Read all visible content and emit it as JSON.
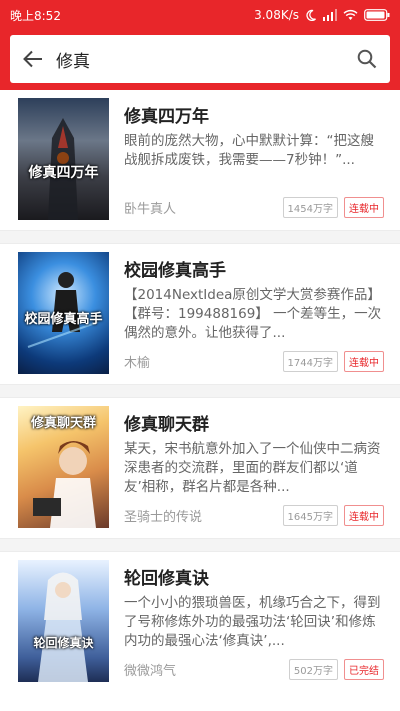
{
  "status_bar": {
    "time": "晚上8:52",
    "network_speed": "3.08K/s"
  },
  "search": {
    "query": "修真"
  },
  "results": [
    {
      "title": "修真四万年",
      "description": "眼前的庞然大物，心中默默计算：“把这艘战舰拆成废铁，我需要——7秒钟！”...",
      "author": "卧牛真人",
      "word_count": "1454万字",
      "status": "连载中",
      "cover_text": "修真四万年"
    },
    {
      "title": "校园修真高手",
      "description": "【2014NextIdea原创文学大赏参赛作品】【群号：199488169】 一个差等生，一次偶然的意外。让他获得了...",
      "author": "木榆",
      "word_count": "1744万字",
      "status": "连载中",
      "cover_text": "校园修真高手"
    },
    {
      "title": "修真聊天群",
      "description": "某天，宋书航意外加入了一个仙侠中二病资深患者的交流群，里面的群友们都以‘道友’相称，群名片都是各种...",
      "author": "圣骑士的传说",
      "word_count": "1645万字",
      "status": "连载中",
      "cover_text": "修真聊天群"
    },
    {
      "title": "轮回修真诀",
      "description": "一个小小的猥琐兽医，机缘巧合之下，得到了号称修炼外功的最强功法‘轮回诀’和修炼内功的最强心法‘修真诀’,...",
      "author": "微微鸿气",
      "word_count": "502万字",
      "status": "已完结",
      "cover_text": "轮回修真诀"
    }
  ],
  "colors": {
    "brand": "#e8262a",
    "status_badge": "#e8262a"
  }
}
